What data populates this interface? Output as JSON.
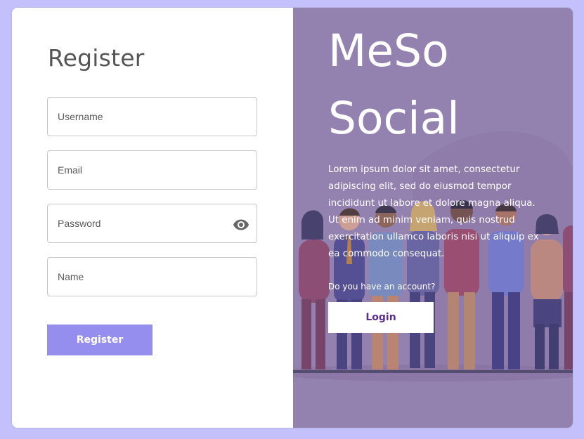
{
  "register_form": {
    "title": "Register",
    "fields": {
      "username": {
        "placeholder": "Username",
        "value": ""
      },
      "email": {
        "placeholder": "Email",
        "value": ""
      },
      "password": {
        "placeholder": "Password",
        "value": "",
        "toggle_icon": "eye-icon"
      },
      "name": {
        "placeholder": "Name",
        "value": ""
      }
    },
    "submit_label": "Register"
  },
  "hero": {
    "title_line1": "MeSo",
    "title_line2": "Social",
    "description": "Lorem ipsum dolor sit amet, consectetur adipiscing elit, sed do eiusmod tempor incididunt ut labore et dolore magna aliqua. Ut enim ad minim veniam, quis nostrud exercitation ullamco laboris nisi ut aliquip ex ea commodo consequat.",
    "account_prompt": "Do you have an account?",
    "login_label": "Login",
    "illustration": "crowd-of-people-illustration"
  },
  "colors": {
    "page_background": "#c4c0fc",
    "register_button": "#968eef",
    "hero_overlay": "#9481b0",
    "login_text": "#5b2f8e"
  }
}
